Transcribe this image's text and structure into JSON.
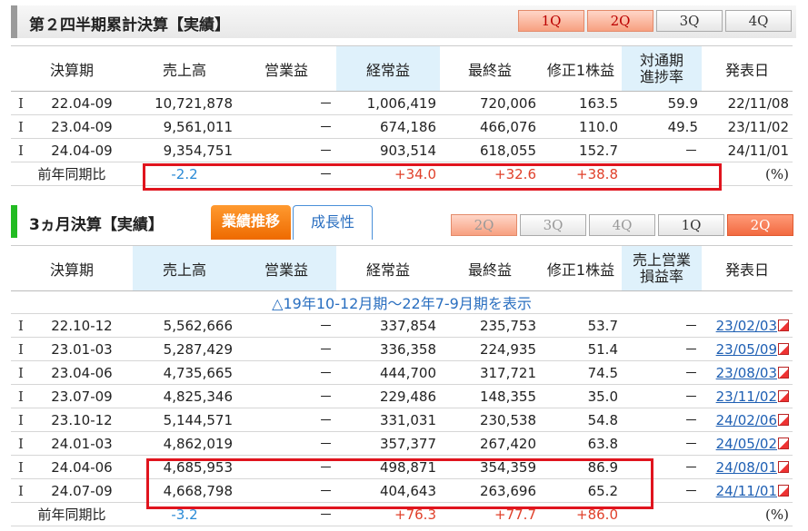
{
  "cumulative": {
    "title": "第２四半期累計決算【実績】",
    "tabs": [
      "1Q",
      "2Q",
      "3Q",
      "4Q"
    ],
    "headers": [
      "決算期",
      "売上高",
      "営業益",
      "経常益",
      "最終益",
      "修正1株益",
      "対通期\n進捗率",
      "発表日"
    ],
    "rows": [
      {
        "mark": "I",
        "period": "22.04-09",
        "sales": "10,721,878",
        "op": "－",
        "ordinary": "1,006,419",
        "net": "720,006",
        "eps": "163.5",
        "progress": "59.9",
        "date": "22/11/08"
      },
      {
        "mark": "I",
        "period": "23.04-09",
        "sales": "9,561,011",
        "op": "－",
        "ordinary": "674,186",
        "net": "466,076",
        "eps": "110.0",
        "progress": "49.5",
        "date": "23/11/02"
      },
      {
        "mark": "I",
        "period": "24.04-09",
        "sales": "9,354,751",
        "op": "－",
        "ordinary": "903,514",
        "net": "618,055",
        "eps": "152.7",
        "progress": "－",
        "date": "24/11/01"
      }
    ],
    "yoy": {
      "label": "前年同期比",
      "sales": "-2.2",
      "op": "－",
      "ordinary": "+34.0",
      "net": "+32.6",
      "eps": "+38.8",
      "unit": "(%)"
    }
  },
  "quarterly": {
    "title": "3ヵ月決算【実績】",
    "btn_trend": "業績推移",
    "btn_growth": "成長性",
    "tabs": [
      "2Q",
      "3Q",
      "4Q",
      "1Q",
      "2Q"
    ],
    "headers": [
      "決算期",
      "売上高",
      "営業益",
      "経常益",
      "最終益",
      "修正1株益",
      "売上営業\n損益率",
      "発表日"
    ],
    "expander": "△19年10-12月期～22年7-9月期を表示",
    "rows": [
      {
        "mark": "I",
        "period": "22.10-12",
        "sales": "5,562,666",
        "op": "－",
        "ordinary": "337,854",
        "net": "235,753",
        "eps": "53.7",
        "margin": "－",
        "date": "23/02/03"
      },
      {
        "mark": "I",
        "period": "23.01-03",
        "sales": "5,287,429",
        "op": "－",
        "ordinary": "336,358",
        "net": "224,935",
        "eps": "51.4",
        "margin": "－",
        "date": "23/05/09"
      },
      {
        "mark": "I",
        "period": "23.04-06",
        "sales": "4,735,665",
        "op": "－",
        "ordinary": "444,700",
        "net": "317,721",
        "eps": "74.5",
        "margin": "－",
        "date": "23/08/03"
      },
      {
        "mark": "I",
        "period": "23.07-09",
        "sales": "4,825,346",
        "op": "－",
        "ordinary": "229,486",
        "net": "148,355",
        "eps": "35.0",
        "margin": "－",
        "date": "23/11/02"
      },
      {
        "mark": "I",
        "period": "23.10-12",
        "sales": "5,144,571",
        "op": "－",
        "ordinary": "331,031",
        "net": "230,538",
        "eps": "54.8",
        "margin": "－",
        "date": "24/02/06"
      },
      {
        "mark": "I",
        "period": "24.01-03",
        "sales": "4,862,019",
        "op": "－",
        "ordinary": "357,377",
        "net": "267,420",
        "eps": "63.8",
        "margin": "－",
        "date": "24/05/02"
      },
      {
        "mark": "I",
        "period": "24.04-06",
        "sales": "4,685,953",
        "op": "－",
        "ordinary": "498,871",
        "net": "354,359",
        "eps": "86.9",
        "margin": "－",
        "date": "24/08/01"
      },
      {
        "mark": "I",
        "period": "24.07-09",
        "sales": "4,668,798",
        "op": "－",
        "ordinary": "404,643",
        "net": "263,696",
        "eps": "65.2",
        "margin": "－",
        "date": "24/11/01"
      }
    ],
    "yoy": {
      "label": "前年同期比",
      "sales": "-3.2",
      "op": "－",
      "ordinary": "+76.3",
      "net": "+77.7",
      "eps": "+86.0",
      "unit": "(%)"
    }
  },
  "colors": {
    "highlight_box": "#e0141e",
    "header_highlight": "#dff1fb",
    "link": "#1e5fb3",
    "positive": "#e0402a",
    "negative": "#2a8ad6"
  }
}
